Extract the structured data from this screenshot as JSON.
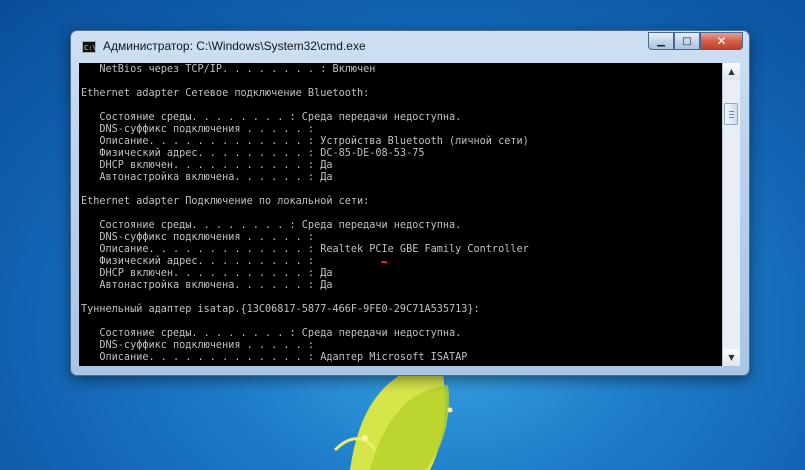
{
  "window": {
    "title": "Администратор: C:\\Windows\\System32\\cmd.exe",
    "icon_label": "C:\\",
    "controls": {
      "minimize": "▁",
      "maximize": "□",
      "close": "✕"
    }
  },
  "console_lines": [
    "   NetBios через TCP/IP. . . . . . . . : Включен",
    "",
    "Ethernet adapter Сетевое подключение Bluetooth:",
    "",
    "   Состояние среды. . . . . . . . : Среда передачи недоступна.",
    "   DNS-суффикс подключения . . . . . :",
    "   Описание. . . . . . . . . . . . . : Устройства Bluetooth (личной сети)",
    "   Физический адрес. . . . . . . . . : DC-85-DE-08-53-75",
    "   DHCP включен. . . . . . . . . . . : Да",
    "   Автонастройка включена. . . . . . : Да",
    "",
    "Ethernet adapter Подключение по локальной сети:",
    "",
    "   Состояние среды. . . . . . . . : Среда передачи недоступна.",
    "   DNS-суффикс подключения . . . . . :",
    "   Описание. . . . . . . . . . . . . : Realtek PCIe GBE Family Controller",
    "   Физический адрес. . . . . . . . . :",
    "   DHCP включен. . . . . . . . . . . : Да",
    "   Автонастройка включена. . . . . . : Да",
    "",
    "Туннельный адаптер isatap.{13C06817-5877-466F-9FE0-29C71A535713}:",
    "",
    "   Состояние среды. . . . . . . . : Среда передачи недоступна.",
    "   DNS-суффикс подключения . . . . . :",
    "   Описание. . . . . . . . . . . . . : Адаптер Microsoft ISATAP"
  ],
  "scrollbar": {
    "up_arrow": "▲",
    "down_arrow": "▼"
  },
  "colors": {
    "console_bg": "#000000",
    "console_text": "#c0c0c0",
    "desktop_bg": "#1e7cc8"
  }
}
